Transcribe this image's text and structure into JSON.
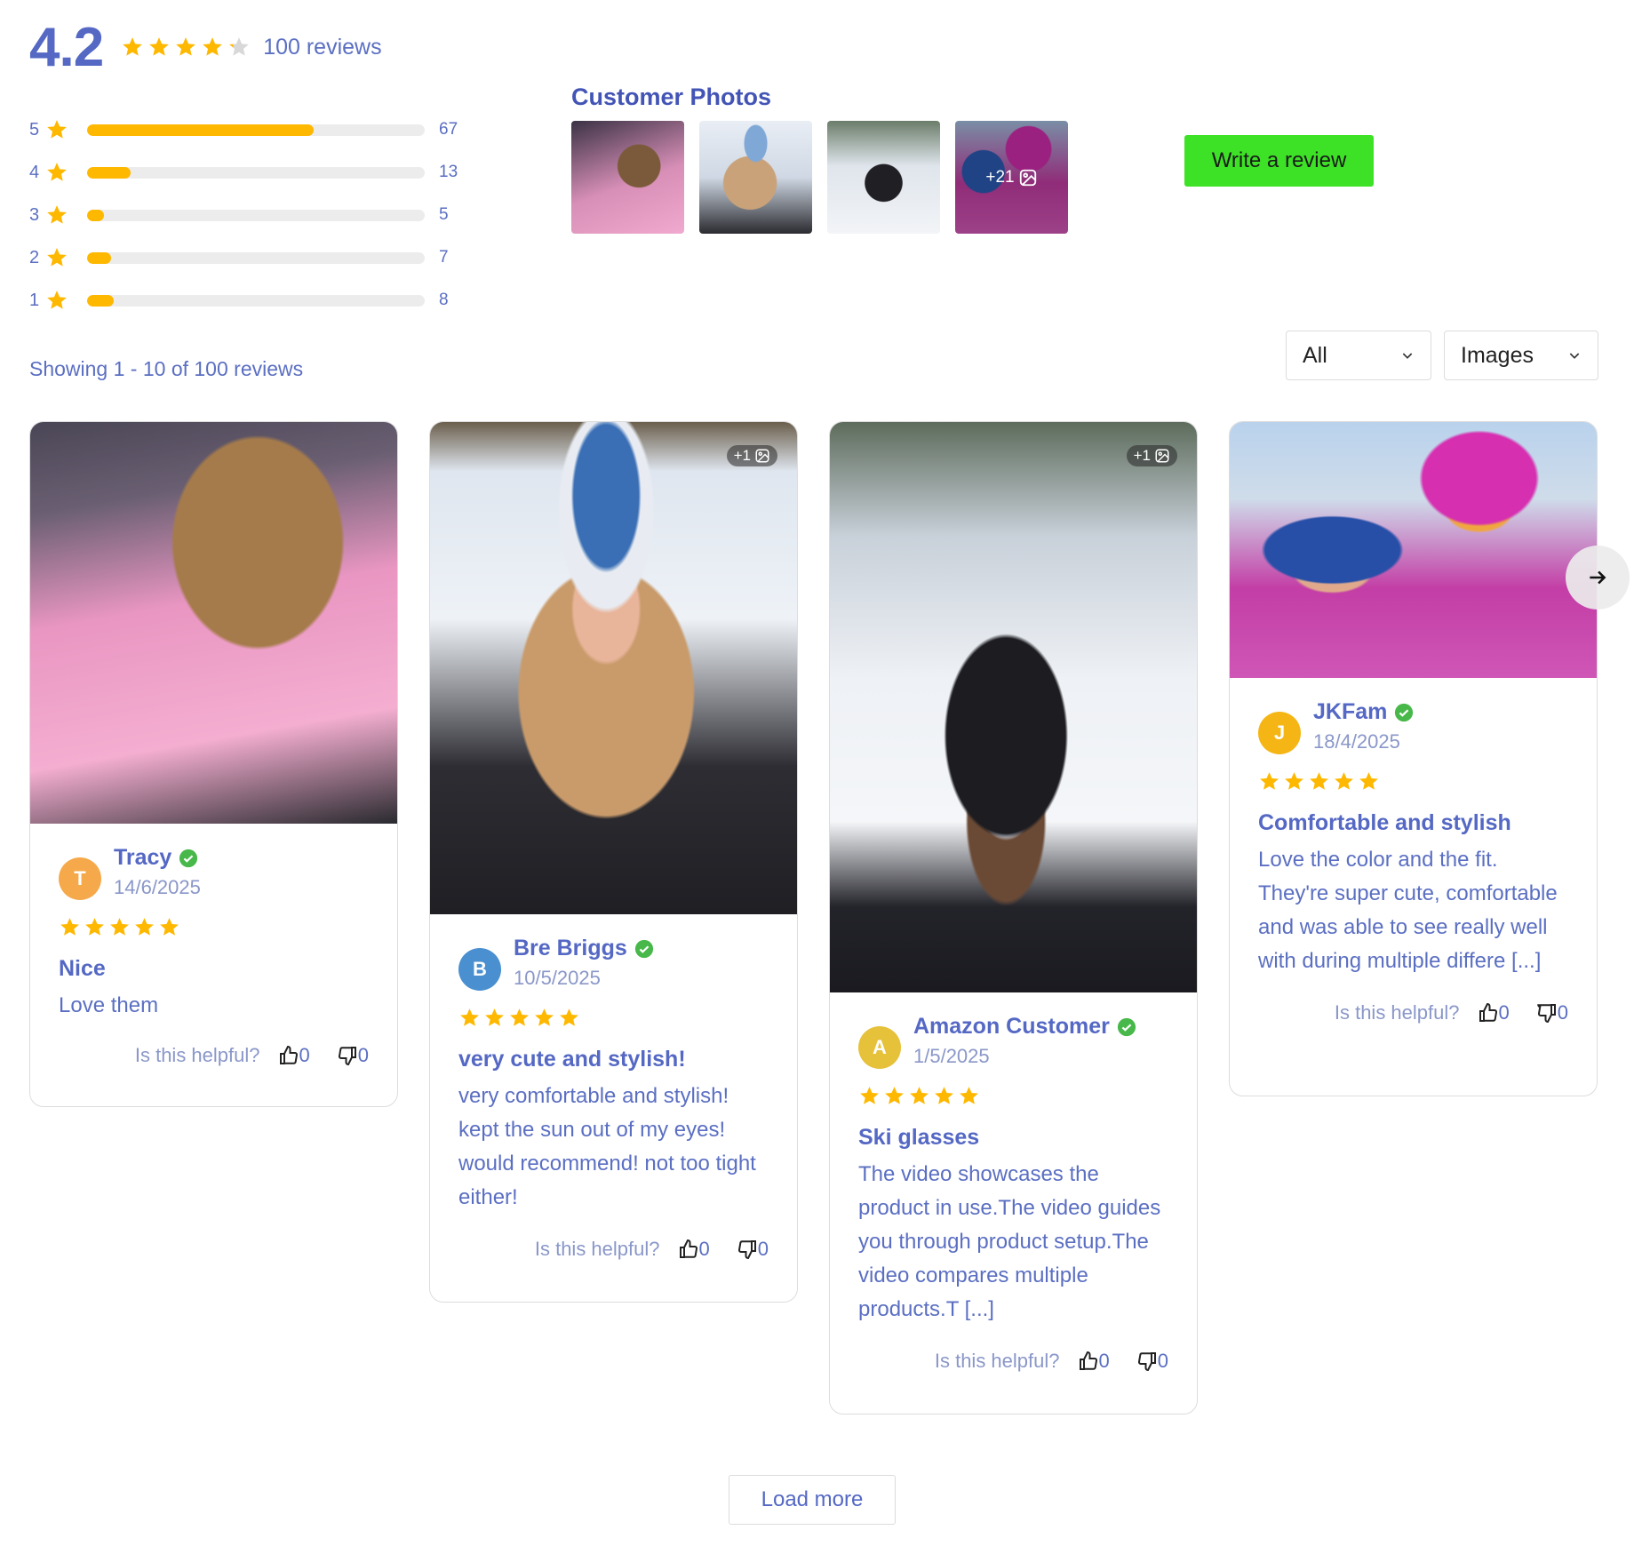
{
  "summary": {
    "average": "4.2",
    "average_rating": 4.2,
    "review_count_label": "100 reviews",
    "star_color": "#ffb800",
    "histogram": [
      {
        "stars": "5",
        "count": "67",
        "fraction": 0.67
      },
      {
        "stars": "4",
        "count": "13",
        "fraction": 0.13
      },
      {
        "stars": "3",
        "count": "5",
        "fraction": 0.05
      },
      {
        "stars": "2",
        "count": "7",
        "fraction": 0.07
      },
      {
        "stars": "1",
        "count": "8",
        "fraction": 0.08
      }
    ]
  },
  "customer_photos": {
    "title": "Customer Photos",
    "more_label": "+21",
    "thumbs": [
      {
        "icon": "photo-pink-fur-jacket"
      },
      {
        "icon": "photo-blonde-skier"
      },
      {
        "icon": "photo-black-helmet-skier"
      },
      {
        "icon": "photo-pink-helmet-skiers"
      }
    ]
  },
  "actions": {
    "write_review": "Write a review",
    "write_review_color": "#3de226",
    "load_more": "Load more"
  },
  "filters": {
    "showing": "Showing 1 - 10 of 100 reviews",
    "rating_filter": "All",
    "media_filter": "Images"
  },
  "helpful_label": "Is this helpful?",
  "reviews": [
    {
      "name": "Tracy",
      "initial": "T",
      "avatar_color": "#f5a94a",
      "date": "14/6/2025",
      "rating": 5,
      "title": "Nice",
      "text": "Love them",
      "image_badge": "",
      "up": "0",
      "down": "0"
    },
    {
      "name": "Bre Briggs",
      "initial": "B",
      "avatar_color": "#4a8fd0",
      "date": "10/5/2025",
      "rating": 5,
      "title": "very cute and stylish!",
      "text": "very comfortable and stylish! kept the sun out of my eyes! would recommend! not too tight either!",
      "image_badge": "+1",
      "up": "0",
      "down": "0"
    },
    {
      "name": "Amazon Customer",
      "initial": "A",
      "avatar_color": "#e6c13a",
      "date": "1/5/2025",
      "rating": 5,
      "title": "Ski glasses",
      "text": "The video showcases the product in use.The video guides you through product setup.The video compares multiple products.T [...]",
      "image_badge": "+1",
      "up": "0",
      "down": "0"
    },
    {
      "name": "JKFam",
      "initial": "J",
      "avatar_color": "#f5b515",
      "date": "18/4/2025",
      "rating": 5,
      "title": "Comfortable and stylish",
      "text": "Love the color and the fit. They're super cute, comfortable and was able to see really well with during multiple differe [...]",
      "image_badge": "",
      "up": "0",
      "down": "0"
    }
  ]
}
